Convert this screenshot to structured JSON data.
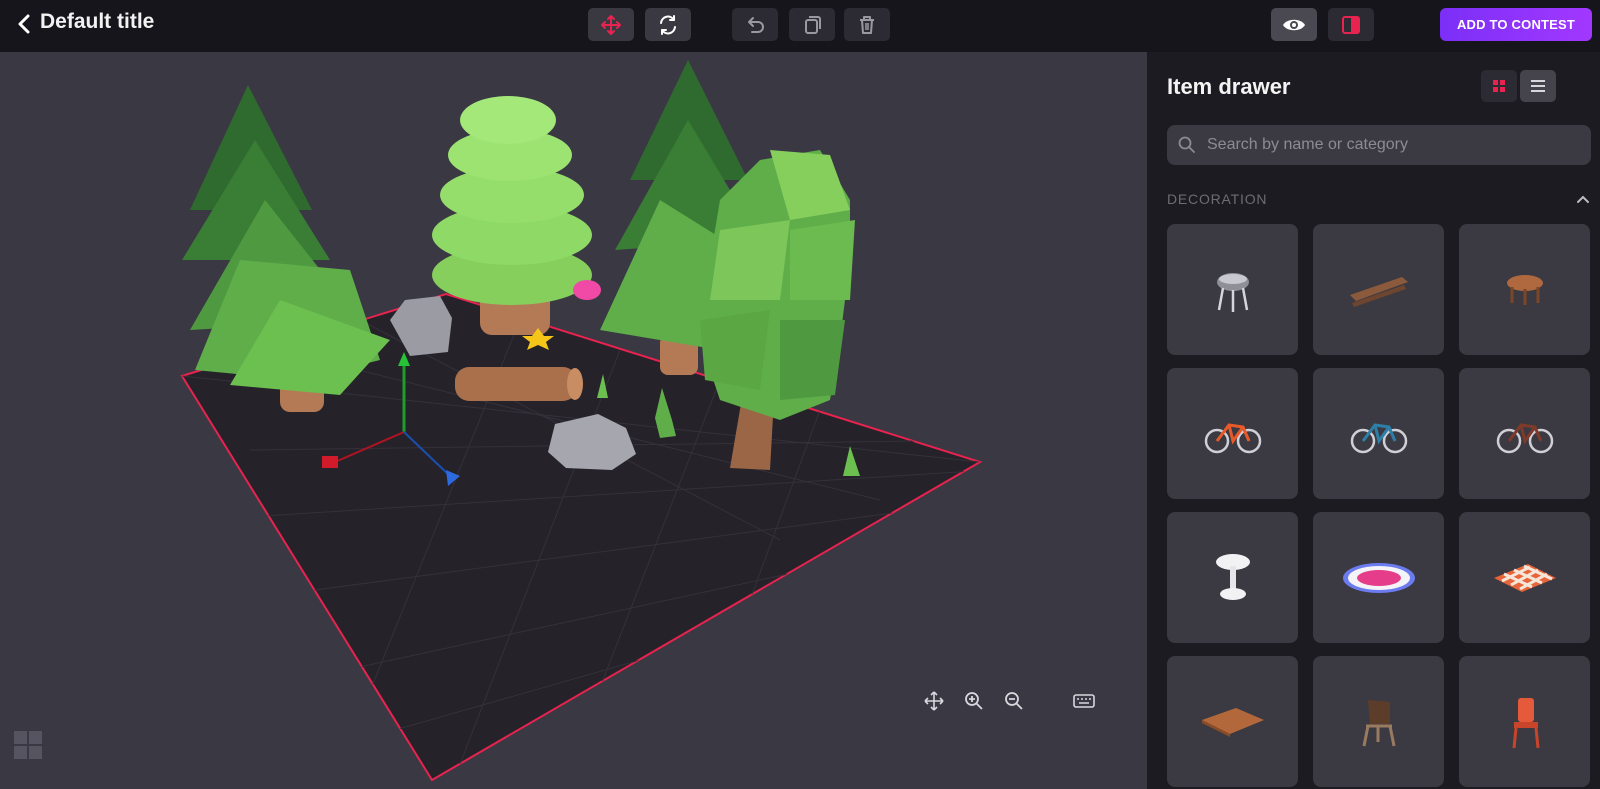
{
  "header": {
    "title": "Default title",
    "cta_label": "ADD TO CONTEST"
  },
  "toolbar": {
    "tools": [
      "move-tool",
      "rotate-tool",
      "undo",
      "duplicate",
      "delete"
    ],
    "view_tools": [
      "preview-eye",
      "split-view"
    ]
  },
  "panel": {
    "title": "Item drawer",
    "search_placeholder": "Search by name or category",
    "section_label": "DECORATION",
    "items": [
      {
        "name": "grill-icon"
      },
      {
        "name": "bench-icon"
      },
      {
        "name": "round-table-icon"
      },
      {
        "name": "red-bicycle-icon"
      },
      {
        "name": "blue-bicycle-icon"
      },
      {
        "name": "brown-bicycle-icon"
      },
      {
        "name": "white-lamp-icon"
      },
      {
        "name": "round-rug-icon"
      },
      {
        "name": "checkered-blanket-icon"
      },
      {
        "name": "doormat-icon"
      },
      {
        "name": "folding-chair-icon"
      },
      {
        "name": "red-chair-icon"
      }
    ]
  },
  "colors": {
    "accent": "#e8234f",
    "cta": "#8a33fa",
    "viewport_bg": "#3a3843",
    "ground": "#25222a"
  }
}
